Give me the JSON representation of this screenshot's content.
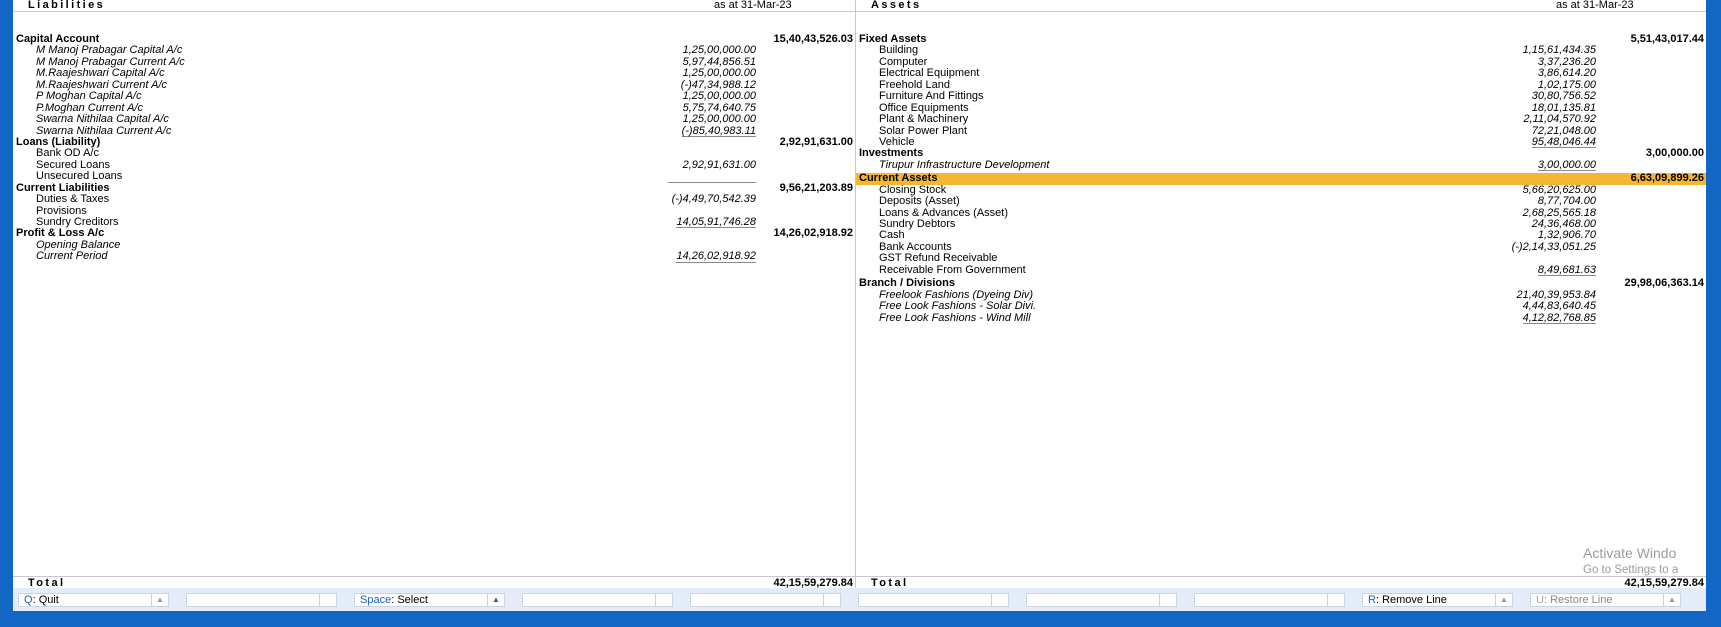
{
  "liabilities": {
    "title": "Liabilities",
    "as_at": "as at 31-Mar-23",
    "groups": [
      {
        "name": "Capital Account",
        "total": "15,40,43,526.03",
        "items": [
          {
            "label": "M Manoj Prabagar Capital A/c",
            "value": "1,25,00,000.00"
          },
          {
            "label": "M Manoj Prabagar Current A/c",
            "value": "5,97,44,856.51"
          },
          {
            "label": "M.Raajeshwari Capital A/c",
            "value": "1,25,00,000.00"
          },
          {
            "label": "M.Raajeshwari Current A/c",
            "value": "(-)47,34,988.12"
          },
          {
            "label": "P Moghan Capital A/c",
            "value": "1,25,00,000.00"
          },
          {
            "label": "P.Moghan Current A/c",
            "value": "5,75,74,640.75"
          },
          {
            "label": "Swarna Nithilaa Capital A/c",
            "value": "1,25,00,000.00"
          },
          {
            "label": "Swarna Nithilaa Current A/c",
            "value": "(-)85,40,983.11"
          }
        ]
      },
      {
        "name": "Loans (Liability)",
        "total": "2,92,91,631.00",
        "items": [
          {
            "label": "Bank OD A/c",
            "value": ""
          },
          {
            "label": "Secured Loans",
            "value": "2,92,91,631.00"
          },
          {
            "label": "Unsecured Loans",
            "value": ""
          }
        ]
      },
      {
        "name": "Current Liabilities",
        "total": "9,56,21,203.89",
        "items": [
          {
            "label": "Duties & Taxes",
            "value": "(-)4,49,70,542.39"
          },
          {
            "label": "Provisions",
            "value": ""
          },
          {
            "label": "Sundry Creditors",
            "value": "14,05,91,746.28"
          }
        ]
      },
      {
        "name": "Profit & Loss A/c",
        "total": "14,26,02,918.92",
        "items": [
          {
            "label": "Opening Balance",
            "value": ""
          },
          {
            "label": "Current Period",
            "value": "14,26,02,918.92"
          }
        ]
      }
    ],
    "total_label": "Total",
    "total_value": "42,15,59,279.84"
  },
  "assets": {
    "title": "Assets",
    "as_at": "as at 31-Mar-23",
    "groups": [
      {
        "name": "Fixed Assets",
        "total": "5,51,43,017.44",
        "items": [
          {
            "label": "Building",
            "value": "1,15,61,434.35"
          },
          {
            "label": "Computer",
            "value": "3,37,236.20"
          },
          {
            "label": "Electrical Equipment",
            "value": "3,86,614.20"
          },
          {
            "label": "Freehold Land",
            "value": "1,02,175.00"
          },
          {
            "label": "Furniture And Fittings",
            "value": "30,80,756.52"
          },
          {
            "label": "Office Equipments",
            "value": "18,01,135.81"
          },
          {
            "label": "Plant & Machinery",
            "value": "2,11,04,570.92"
          },
          {
            "label": "Solar Power Plant",
            "value": "72,21,048.00"
          },
          {
            "label": "Vehicle",
            "value": "95,48,046.44"
          }
        ]
      },
      {
        "name": "Investments",
        "total": "3,00,000.00",
        "items": [
          {
            "label": "Tirupur Infrastructure Development",
            "value": "3,00,000.00"
          }
        ]
      },
      {
        "name": "Current Assets",
        "total": "6,63,09,899.26",
        "items": [
          {
            "label": "Closing Stock",
            "value": "5,66,20,625.00"
          },
          {
            "label": "Deposits (Asset)",
            "value": "8,77,704.00"
          },
          {
            "label": "Loans & Advances (Asset)",
            "value": "2,68,25,565.18"
          },
          {
            "label": "Sundry Debtors",
            "value": "24,36,468.00"
          },
          {
            "label": "Cash",
            "value": "1,32,906.70"
          },
          {
            "label": "Bank Accounts",
            "value": "(-)2,14,33,051.25"
          },
          {
            "label": "GST Refund Receivable",
            "value": ""
          },
          {
            "label": "Receivable From Government",
            "value": "8,49,681.63"
          }
        ]
      },
      {
        "name": "Branch / Divisions",
        "total": "29,98,06,363.14",
        "items": [
          {
            "label": "Freelook Fashions (Dyeing Div)",
            "value": "21,40,39,953.84"
          },
          {
            "label": "Free Look Fashions - Solar Divi.",
            "value": "4,44,83,640.45"
          },
          {
            "label": "Free Look Fashions - Wind Mill",
            "value": "4,12,82,768.85"
          }
        ]
      }
    ],
    "total_label": "Total",
    "total_value": "42,15,59,279.84"
  },
  "footer": {
    "quit_key": "Q",
    "quit_label": "Quit",
    "select_key": "Space",
    "select_label": "Select",
    "remove_key": "R",
    "remove_label": "Remove Line",
    "restore_key": "U",
    "restore_label": "Restore Line"
  },
  "watermark": {
    "line1": "Activate Windo",
    "line2": "Go to Settings to a"
  },
  "colors": {
    "highlight": "#f7b62f",
    "frame": "#1266c4",
    "hotkey": "#1f5fb5"
  }
}
